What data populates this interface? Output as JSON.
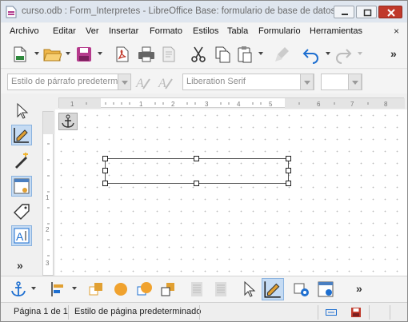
{
  "window": {
    "title": "curso.odb : Form_Interpretes - LibreOffice Base: formulario de base de datos",
    "minimize": "minimize-icon",
    "maximize": "maximize-icon",
    "close": "close-icon"
  },
  "menubar": {
    "items": [
      "Archivo",
      "Editar",
      "Ver",
      "Insertar",
      "Formato",
      "Estilos",
      "Tabla",
      "Formulario",
      "Herramientas"
    ],
    "close_doc": "×"
  },
  "toolbar1": {
    "icons": [
      "new-document-icon",
      "open-folder-icon",
      "save-icon",
      "export-pdf-icon",
      "print-icon",
      "print-preview-icon",
      "cut-icon",
      "copy-icon",
      "paste-icon",
      "clone-formatting-icon",
      "undo-icon",
      "redo-icon"
    ],
    "overflow": "»"
  },
  "toolbar2": {
    "paragraph_style": "Estilo de párrafo predetermina",
    "font_name": "Liberation Serif",
    "font_size": "",
    "icons": [
      "update-style-icon",
      "new-style-icon"
    ]
  },
  "form_controls_sidebar": {
    "icons": [
      "select-icon",
      "design-mode-icon",
      "wizards-icon",
      "form-properties-icon",
      "tab-order-icon",
      "form-navigator-icon"
    ],
    "overflow": "»"
  },
  "ruler": {
    "h_ticks": [
      "1",
      "1",
      "2",
      "3",
      "4",
      "5",
      "6",
      "7",
      "8"
    ],
    "v_ticks": [
      "1",
      "2",
      "3"
    ]
  },
  "bottombar": {
    "icons": [
      "anchor-icon",
      "align-objects-icon",
      "bring-to-front-icon",
      "circle-front-icon",
      "circle-back-icon",
      "send-to-back-icon",
      "page-icon-1",
      "page-icon-2",
      "select-cursor-icon",
      "design-mode-icon",
      "control-properties-icon",
      "form-icon"
    ],
    "overflow": "»"
  },
  "statusbar": {
    "page": "Página 1 de 1",
    "page_style": "Estilo de página predeterminado",
    "icons": [
      "selection-mode-icon",
      "document-modified-icon",
      "signature-icon"
    ]
  },
  "colors": {
    "accent": "#1e6fd0",
    "active_bg": "#c5dbf3",
    "close_red": "#c0392b"
  }
}
